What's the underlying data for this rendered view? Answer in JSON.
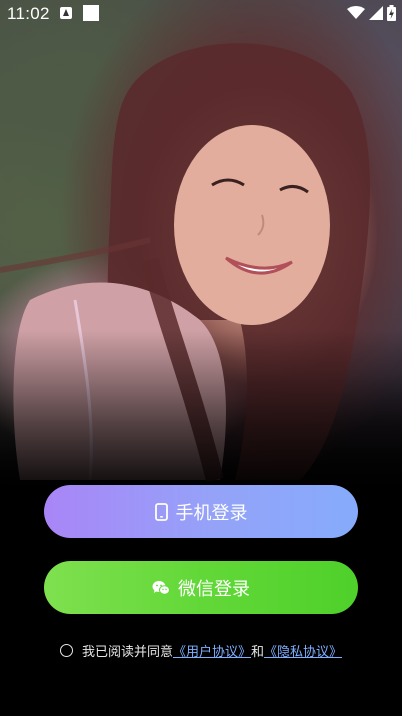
{
  "status_bar": {
    "time": "11:02",
    "icons": [
      "a-notification-icon",
      "square-notification-icon",
      "wifi-icon",
      "signal-icon",
      "battery-charging-icon"
    ]
  },
  "buttons": {
    "phone_login": {
      "label": "手机登录",
      "icon": "phone-icon"
    },
    "wechat_login": {
      "label": "微信登录",
      "icon": "wechat-icon"
    }
  },
  "agreement": {
    "prefix": "我已阅读并同意",
    "user_agreement": "《用户协议》",
    "and": "和",
    "privacy_agreement": "《隐私协议》"
  },
  "colors": {
    "phone_button_start": "#a985f7",
    "phone_button_end": "#86abfb",
    "wechat_button_start": "#7fe04f",
    "wechat_button_end": "#4fd02a",
    "link": "#7fb0ff"
  }
}
